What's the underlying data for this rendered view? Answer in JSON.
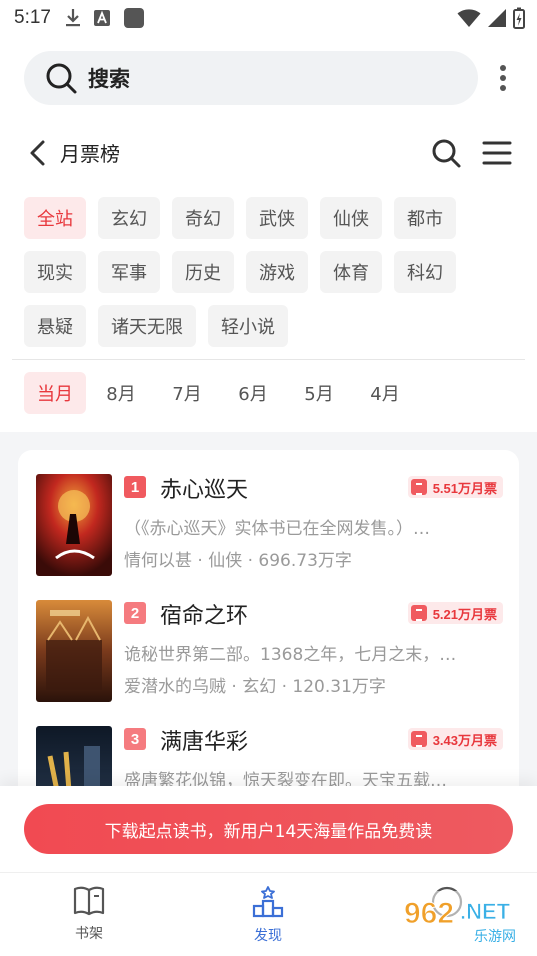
{
  "status_bar": {
    "time": "5:17"
  },
  "search": {
    "label": "搜索"
  },
  "header": {
    "title": "月票榜"
  },
  "categories": [
    "全站",
    "玄幻",
    "奇幻",
    "武侠",
    "仙侠",
    "都市",
    "现实",
    "军事",
    "历史",
    "游戏",
    "体育",
    "科幻",
    "悬疑",
    "诸天无限",
    "轻小说"
  ],
  "active_category": "全站",
  "months": [
    "当月",
    "8月",
    "7月",
    "6月",
    "5月",
    "4月"
  ],
  "active_month": "当月",
  "books": [
    {
      "rank": "1",
      "title": "赤心巡天",
      "votes": "5.51万月票",
      "desc": "（《赤心巡天》实体书已在全网发售。）…",
      "meta": "情何以甚 · 仙侠 · 696.73万字",
      "cover_color": "#b3241e"
    },
    {
      "rank": "2",
      "title": "宿命之环",
      "votes": "5.21万月票",
      "desc": "诡秘世界第二部。1368之年，七月之末，…",
      "meta": "爱潜水的乌贼 · 玄幻 · 120.31万字",
      "cover_color": "#7a3a1c"
    },
    {
      "rank": "3",
      "title": "满唐华彩",
      "votes": "3.43万月票",
      "desc": "盛唐繁花似锦，惊天裂变在即。天宝五载…",
      "meta": "",
      "cover_color": "#1d2b3f"
    }
  ],
  "banner": {
    "text": "下载起点读书，新用户14天海量作品免费读"
  },
  "nav": [
    {
      "label": "书架",
      "icon": "book-icon"
    },
    {
      "label": "发现",
      "icon": "discover-icon"
    }
  ],
  "watermark": {
    "text": "962.NET",
    "subtext": "乐游网"
  },
  "colors": {
    "accent": "#e8383d",
    "nav_active": "#3b6fd6"
  }
}
